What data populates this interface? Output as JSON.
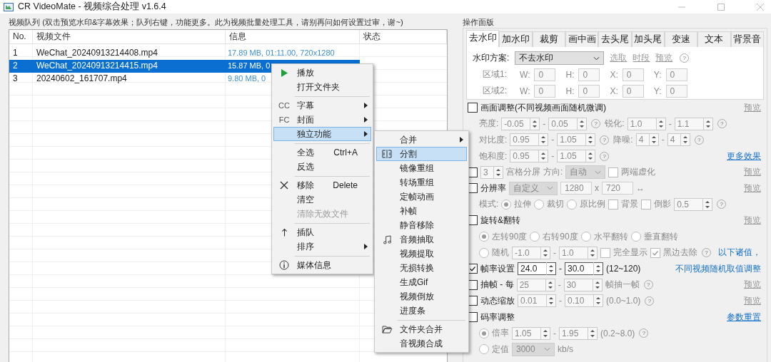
{
  "window": {
    "title": "CR VideoMate - 视频综合处理 v1.6.4"
  },
  "queue": {
    "title": "视频队列 (双击预览水印&字幕效果；队列右键，功能更多。此为视频批量处理工具，请别再问如何设置过审，谢~)",
    "columns": [
      "No.",
      "视频文件",
      "信息",
      "状态"
    ],
    "rows": [
      {
        "no": "1",
        "file": "WeChat_20240913214408.mp4",
        "info": "17.89 MB, 01:11.00, 720x1280",
        "selected": false
      },
      {
        "no": "2",
        "file": "WeChat_20240913214415.mp4",
        "info": "15.87 MB, 0",
        "selected": true
      },
      {
        "no": "3",
        "file": "20240602_161707.mp4",
        "info": "9.80 MB, 0",
        "selected": false
      }
    ]
  },
  "context_menu": {
    "items": [
      {
        "kind": "play",
        "label": "播放",
        "submenu": false,
        "selected": false,
        "disabled": false
      },
      {
        "kind": "item",
        "label": "打开文件夹",
        "submenu": false,
        "selected": false,
        "disabled": false
      },
      {
        "kind": "separator"
      },
      {
        "kind": "item",
        "label": "字幕",
        "badge": "CC",
        "submenu": true,
        "selected": false,
        "disabled": false
      },
      {
        "kind": "item",
        "label": "封面",
        "badge": "FC",
        "submenu": true,
        "selected": false,
        "disabled": false
      },
      {
        "kind": "item",
        "label": "独立功能",
        "submenu": true,
        "selected": true,
        "disabled": false
      },
      {
        "kind": "separator"
      },
      {
        "kind": "item",
        "label": "全选",
        "shortcut": "Ctrl+A",
        "submenu": false,
        "selected": false,
        "disabled": false
      },
      {
        "kind": "item",
        "label": "反选",
        "submenu": false,
        "selected": false,
        "disabled": false
      },
      {
        "kind": "separator"
      },
      {
        "kind": "close",
        "label": "移除",
        "shortcut": "Delete",
        "submenu": false,
        "selected": false,
        "disabled": false
      },
      {
        "kind": "item",
        "label": "清空",
        "submenu": false,
        "selected": false,
        "disabled": false
      },
      {
        "kind": "item",
        "label": "清除无效文件",
        "submenu": false,
        "selected": false,
        "disabled": true
      },
      {
        "kind": "separator"
      },
      {
        "kind": "up",
        "label": "插队",
        "submenu": false,
        "selected": false,
        "disabled": false
      },
      {
        "kind": "item",
        "label": "排序",
        "submenu": true,
        "selected": false,
        "disabled": false
      },
      {
        "kind": "separator"
      },
      {
        "kind": "info",
        "label": "媒体信息",
        "submenu": false,
        "selected": false,
        "disabled": false
      }
    ]
  },
  "submenu": {
    "items": [
      {
        "kind": "item",
        "label": "合并",
        "submenu": true,
        "selected": false,
        "disabled": false
      },
      {
        "kind": "split",
        "label": "分割",
        "submenu": false,
        "selected": true,
        "disabled": false
      },
      {
        "kind": "item",
        "label": "镜像重组",
        "submenu": false,
        "selected": false,
        "disabled": false
      },
      {
        "kind": "item",
        "label": "转场重组",
        "submenu": false,
        "selected": false,
        "disabled": false
      },
      {
        "kind": "item",
        "label": "定帧动画",
        "submenu": false,
        "selected": false,
        "disabled": false
      },
      {
        "kind": "item",
        "label": "补帧",
        "submenu": false,
        "selected": false,
        "disabled": false
      },
      {
        "kind": "item",
        "label": "静音移除",
        "submenu": false,
        "selected": false,
        "disabled": false
      },
      {
        "kind": "music",
        "label": "音频抽取",
        "submenu": false,
        "selected": false,
        "disabled": false
      },
      {
        "kind": "item",
        "label": "视频提取",
        "submenu": false,
        "selected": false,
        "disabled": false
      },
      {
        "kind": "item",
        "label": "无损转换",
        "submenu": false,
        "selected": false,
        "disabled": false
      },
      {
        "kind": "item",
        "label": "生成Gif",
        "submenu": false,
        "selected": false,
        "disabled": false
      },
      {
        "kind": "item",
        "label": "视频倒放",
        "submenu": false,
        "selected": false,
        "disabled": false
      },
      {
        "kind": "item",
        "label": "进度条",
        "submenu": false,
        "selected": false,
        "disabled": false
      },
      {
        "kind": "separator"
      },
      {
        "kind": "folder",
        "label": "文件夹合并",
        "submenu": false,
        "selected": false,
        "disabled": false
      },
      {
        "kind": "item",
        "label": "音视频合成",
        "submenu": false,
        "selected": false,
        "disabled": false
      }
    ]
  },
  "panel": {
    "title": "操作面版",
    "tabs": [
      {
        "label": "去水印",
        "selected": true
      },
      {
        "label": "加水印",
        "selected": false
      },
      {
        "label": "裁剪",
        "selected": false
      },
      {
        "label": "画中画",
        "selected": false
      },
      {
        "label": "去头尾",
        "selected": false
      },
      {
        "label": "加头尾",
        "selected": false
      },
      {
        "label": "变速",
        "selected": false
      },
      {
        "label": "文本",
        "selected": false
      },
      {
        "label": "背景音",
        "selected": false
      }
    ],
    "watermark": {
      "scheme_label": "水印方案:",
      "scheme": "不去水印",
      "links": [
        {
          "text": "选取",
          "disabled": true
        },
        {
          "text": "时段",
          "disabled": true
        },
        {
          "text": "预览",
          "disabled": true
        }
      ],
      "help": "?",
      "regions": [
        {
          "label": "区域1:",
          "disabled": true,
          "fields": [
            {
              "label": "W:",
              "value": "0"
            },
            {
              "label": "H:",
              "value": "0"
            },
            {
              "label": "X:",
              "value": "0"
            },
            {
              "label": "Y:",
              "value": "0"
            }
          ]
        },
        {
          "label": "区域2:",
          "disabled": true,
          "fields": [
            {
              "label": "W:",
              "value": "0"
            },
            {
              "label": "H:",
              "value": "0"
            },
            {
              "label": "X:",
              "value": "0"
            },
            {
              "label": "Y:",
              "value": "0"
            }
          ]
        }
      ]
    },
    "sections": [
      {
        "disabled": false,
        "items": [
          {
            "kind": "check",
            "label": "画面调整(不同视频画面随机微调)",
            "checked": false
          }
        ],
        "right": [
          {
            "kind": "link",
            "text": "预览",
            "disabled": true
          }
        ],
        "children": [
          {
            "disabled": true,
            "items": [
              {
                "kind": "text",
                "text": "亮度:"
              },
              {
                "kind": "spin",
                "value": "-0.05"
              },
              {
                "kind": "text",
                "text": "-"
              },
              {
                "kind": "spin",
                "value": "0.05"
              },
              {
                "kind": "help",
                "text": "?"
              },
              {
                "kind": "text",
                "text": "锐化:"
              },
              {
                "kind": "spin",
                "value": "1.0"
              },
              {
                "kind": "text",
                "text": "-"
              },
              {
                "kind": "spin",
                "value": "1.1"
              },
              {
                "kind": "help",
                "text": "?"
              }
            ]
          },
          {
            "disabled": true,
            "items": [
              {
                "kind": "text",
                "text": "对比度:"
              },
              {
                "kind": "spin",
                "value": "0.95"
              },
              {
                "kind": "text",
                "text": "-"
              },
              {
                "kind": "spin",
                "value": "1.05"
              },
              {
                "kind": "help",
                "text": "?"
              },
              {
                "kind": "text",
                "text": "降噪:"
              },
              {
                "kind": "spin",
                "value": "4"
              },
              {
                "kind": "text",
                "text": "-"
              },
              {
                "kind": "spin",
                "value": "4"
              },
              {
                "kind": "help",
                "text": "?"
              }
            ]
          },
          {
            "disabled": true,
            "items": [
              {
                "kind": "text",
                "text": "饱和度:"
              },
              {
                "kind": "spin",
                "value": "0.95"
              },
              {
                "kind": "text",
                "text": "-"
              },
              {
                "kind": "spin",
                "value": "1.05"
              },
              {
                "kind": "help",
                "text": "?"
              }
            ],
            "right": [
              {
                "kind": "link",
                "text": "更多效果",
                "disabled": false
              }
            ]
          }
        ]
      },
      {
        "disabled": true,
        "items": [
          {
            "kind": "check",
            "checked": false
          },
          {
            "kind": "spin",
            "value": "3"
          },
          {
            "kind": "text",
            "text": "宫格分屏"
          },
          {
            "kind": "text",
            "text": "方向:"
          },
          {
            "kind": "combo",
            "value": "自动"
          },
          {
            "kind": "check",
            "label": "两端虚化",
            "checked": false
          }
        ],
        "right": [
          {
            "kind": "link",
            "text": "预览",
            "disabled": true
          }
        ]
      },
      {
        "disabled": true,
        "items": [
          {
            "kind": "check",
            "label": "分辨率",
            "checked": false
          },
          {
            "kind": "combo",
            "value": "自定义"
          },
          {
            "kind": "input",
            "value": "1280"
          },
          {
            "kind": "text",
            "text": "x"
          },
          {
            "kind": "input",
            "value": "720"
          },
          {
            "kind": "text",
            "text": "↔"
          }
        ],
        "right": [
          {
            "kind": "link",
            "text": "预览",
            "disabled": true
          }
        ],
        "children": [
          {
            "disabled": true,
            "items": [
              {
                "kind": "text",
                "text": "模式:"
              },
              {
                "kind": "radio",
                "label": "拉伸",
                "selected": true
              },
              {
                "kind": "radio",
                "label": "裁切",
                "selected": false
              },
              {
                "kind": "radio",
                "label": "原比例",
                "selected": false
              },
              {
                "kind": "check",
                "label": "背景",
                "checked": false
              },
              {
                "kind": "check",
                "label": "倒影",
                "checked": false
              },
              {
                "kind": "spin",
                "value": "0.5"
              },
              {
                "kind": "help",
                "text": "?"
              }
            ]
          }
        ]
      },
      {
        "disabled": false,
        "items": [
          {
            "kind": "check",
            "label": "旋转&翻转",
            "checked": false
          }
        ],
        "right": [
          {
            "kind": "link",
            "text": "预览",
            "disabled": true
          }
        ],
        "children": [
          {
            "disabled": true,
            "items": [
              {
                "kind": "radio",
                "label": "左转90度",
                "selected": true
              },
              {
                "kind": "radio",
                "label": "右转90度",
                "selected": false
              },
              {
                "kind": "radio",
                "label": "水平翻转",
                "selected": false
              },
              {
                "kind": "radio",
                "label": "垂直翻转",
                "selected": false
              }
            ]
          },
          {
            "disabled": true,
            "items": [
              {
                "kind": "radio",
                "label": "随机",
                "selected": false
              },
              {
                "kind": "spin",
                "value": "-1.0"
              },
              {
                "kind": "text",
                "text": "-"
              },
              {
                "kind": "spin",
                "value": "1.0"
              },
              {
                "kind": "check",
                "label": "完全显示",
                "checked": false
              },
              {
                "kind": "check",
                "label": "黑边去除",
                "checked": true
              },
              {
                "kind": "help",
                "text": "?"
              }
            ],
            "right": [
              {
                "kind": "note",
                "text": "以下诸值，"
              }
            ]
          }
        ]
      },
      {
        "disabled": false,
        "items": [
          {
            "kind": "check",
            "label": "帧率设置",
            "checked": true
          },
          {
            "kind": "spin",
            "value": "24.0"
          },
          {
            "kind": "text",
            "text": "-"
          },
          {
            "kind": "spin",
            "value": "30.0"
          },
          {
            "kind": "text",
            "text": "(12~120)"
          }
        ],
        "right": [
          {
            "kind": "note",
            "text": "不同视频随机取值调整"
          }
        ]
      },
      {
        "disabled": true,
        "items": [
          {
            "kind": "check",
            "label": "抽帧 - 每",
            "checked": false
          },
          {
            "kind": "spin",
            "value": "25"
          },
          {
            "kind": "text",
            "text": "-"
          },
          {
            "kind": "spin",
            "value": "30"
          },
          {
            "kind": "text",
            "text": "帧抽一帧"
          },
          {
            "kind": "help",
            "text": "?"
          }
        ],
        "right": [
          {
            "kind": "link",
            "text": "预览",
            "disabled": true
          }
        ]
      },
      {
        "disabled": true,
        "items": [
          {
            "kind": "check",
            "label": "动态缩放",
            "checked": false
          },
          {
            "kind": "spin",
            "value": "0.01"
          },
          {
            "kind": "text",
            "text": "-"
          },
          {
            "kind": "spin",
            "value": "0.10"
          },
          {
            "kind": "text",
            "text": "(0.0~1.0)"
          },
          {
            "kind": "help",
            "text": "?"
          }
        ],
        "right": [
          {
            "kind": "link",
            "text": "预览",
            "disabled": true
          }
        ]
      },
      {
        "disabled": false,
        "items": [
          {
            "kind": "check",
            "label": "码率调整",
            "checked": false
          }
        ],
        "right": [
          {
            "kind": "link",
            "text": "参数重置",
            "disabled": false
          }
        ],
        "children": [
          {
            "disabled": true,
            "items": [
              {
                "kind": "radio",
                "label": "倍率",
                "selected": true
              },
              {
                "kind": "spin",
                "value": "1.05"
              },
              {
                "kind": "text",
                "text": "-"
              },
              {
                "kind": "spin",
                "value": "1.95"
              },
              {
                "kind": "text",
                "text": "(0.2~8.0)"
              },
              {
                "kind": "help",
                "text": "?"
              }
            ]
          },
          {
            "disabled": true,
            "items": [
              {
                "kind": "radio",
                "label": "定值",
                "selected": false
              },
              {
                "kind": "combo",
                "value": "3000"
              },
              {
                "kind": "text",
                "text": "kb/s"
              }
            ]
          }
        ]
      }
    ]
  }
}
